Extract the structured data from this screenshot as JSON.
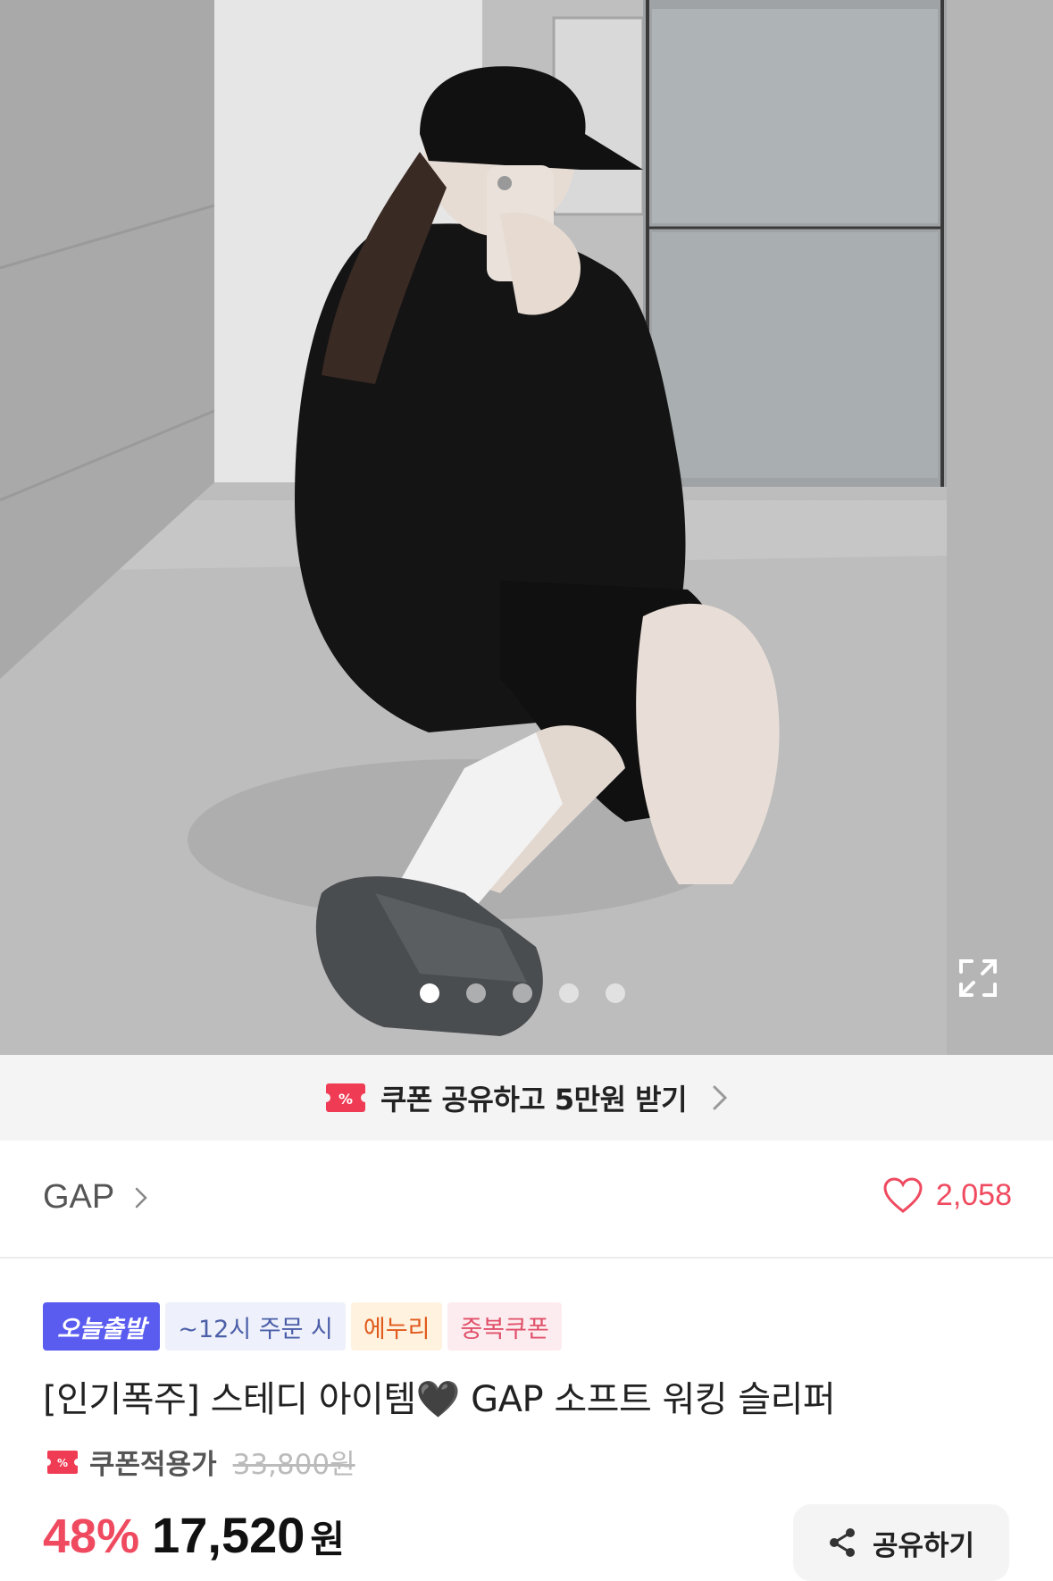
{
  "hero": {
    "image_alt": "",
    "slide_count": 5,
    "active_slide": 1
  },
  "coupon_banner": {
    "text": "쿠폰 공유하고 5만원 받기",
    "icon": "coupon-percent-icon"
  },
  "brand": {
    "name": "GAP",
    "like_count": "2,058"
  },
  "badges": {
    "today": "오늘출발",
    "order": "~12시 주문 시",
    "enuri": "에누리",
    "dup": "중복쿠폰"
  },
  "product": {
    "title": "[인기폭주] 스테디 아이템🖤 GAP 소프트 워킹 슬리퍼",
    "price_label": "쿠폰적용가",
    "original_price": "33,800원",
    "discount": "48%",
    "final_price": "17,520",
    "currency": "원"
  },
  "share": {
    "label": "공유하기"
  },
  "colors": {
    "accent": "#ef4a5f",
    "badge_today": "#5a5cf0"
  }
}
